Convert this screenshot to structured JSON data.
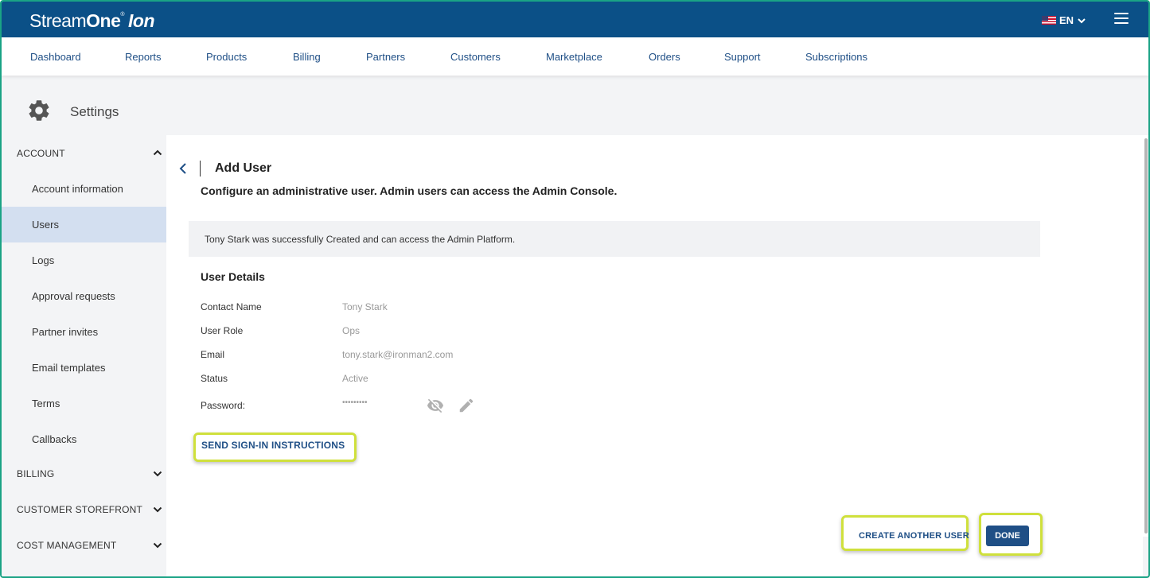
{
  "brand": {
    "part1": "Stream",
    "part2": "One",
    "reg": "®",
    "part3": "Ion"
  },
  "header": {
    "language": "EN"
  },
  "nav": {
    "items": [
      "Dashboard",
      "Reports",
      "Products",
      "Billing",
      "Partners",
      "Customers",
      "Marketplace",
      "Orders",
      "Support",
      "Subscriptions"
    ]
  },
  "settings": {
    "title": "Settings"
  },
  "sidebar": {
    "account_label": "ACCOUNT",
    "account_items": [
      "Account information",
      "Users",
      "Logs",
      "Approval requests",
      "Partner invites",
      "Email templates",
      "Terms",
      "Callbacks"
    ],
    "active_item": "Users",
    "billing_label": "BILLING",
    "storefront_label": "CUSTOMER STOREFRONT",
    "cost_label": "COST MANAGEMENT"
  },
  "page": {
    "title": "Add User",
    "subtitle": "Configure an administrative user. Admin users can access the Admin Console.",
    "alert": "Tony Stark was successfully Created and can access the Admin Platform."
  },
  "details": {
    "title": "User Details",
    "contact_label": "Contact Name",
    "contact_value": "Tony Stark",
    "role_label": "User Role",
    "role_value": "Ops",
    "email_label": "Email",
    "email_value": "tony.stark@ironman2.com",
    "status_label": "Status",
    "status_value": "Active",
    "password_label": "Password:",
    "password_value": "•••••••••"
  },
  "actions": {
    "send_instructions": "SEND SIGN-IN INSTRUCTIONS",
    "create_another": "CREATE ANOTHER USER",
    "done": "DONE"
  },
  "colors": {
    "brand_bar": "#0b5087",
    "link": "#1f4f86",
    "active_sidebar": "#d3dff0",
    "highlight": "#cfe03c"
  },
  "icons": {
    "settings": "gear-icon",
    "menu": "hamburger-menu-icon",
    "language_flag": "us-flag-icon",
    "language_chevron": "chevron-down-icon",
    "back": "chevron-left-icon",
    "password_visibility": "eye-off-icon",
    "password_edit": "pencil-icon"
  }
}
